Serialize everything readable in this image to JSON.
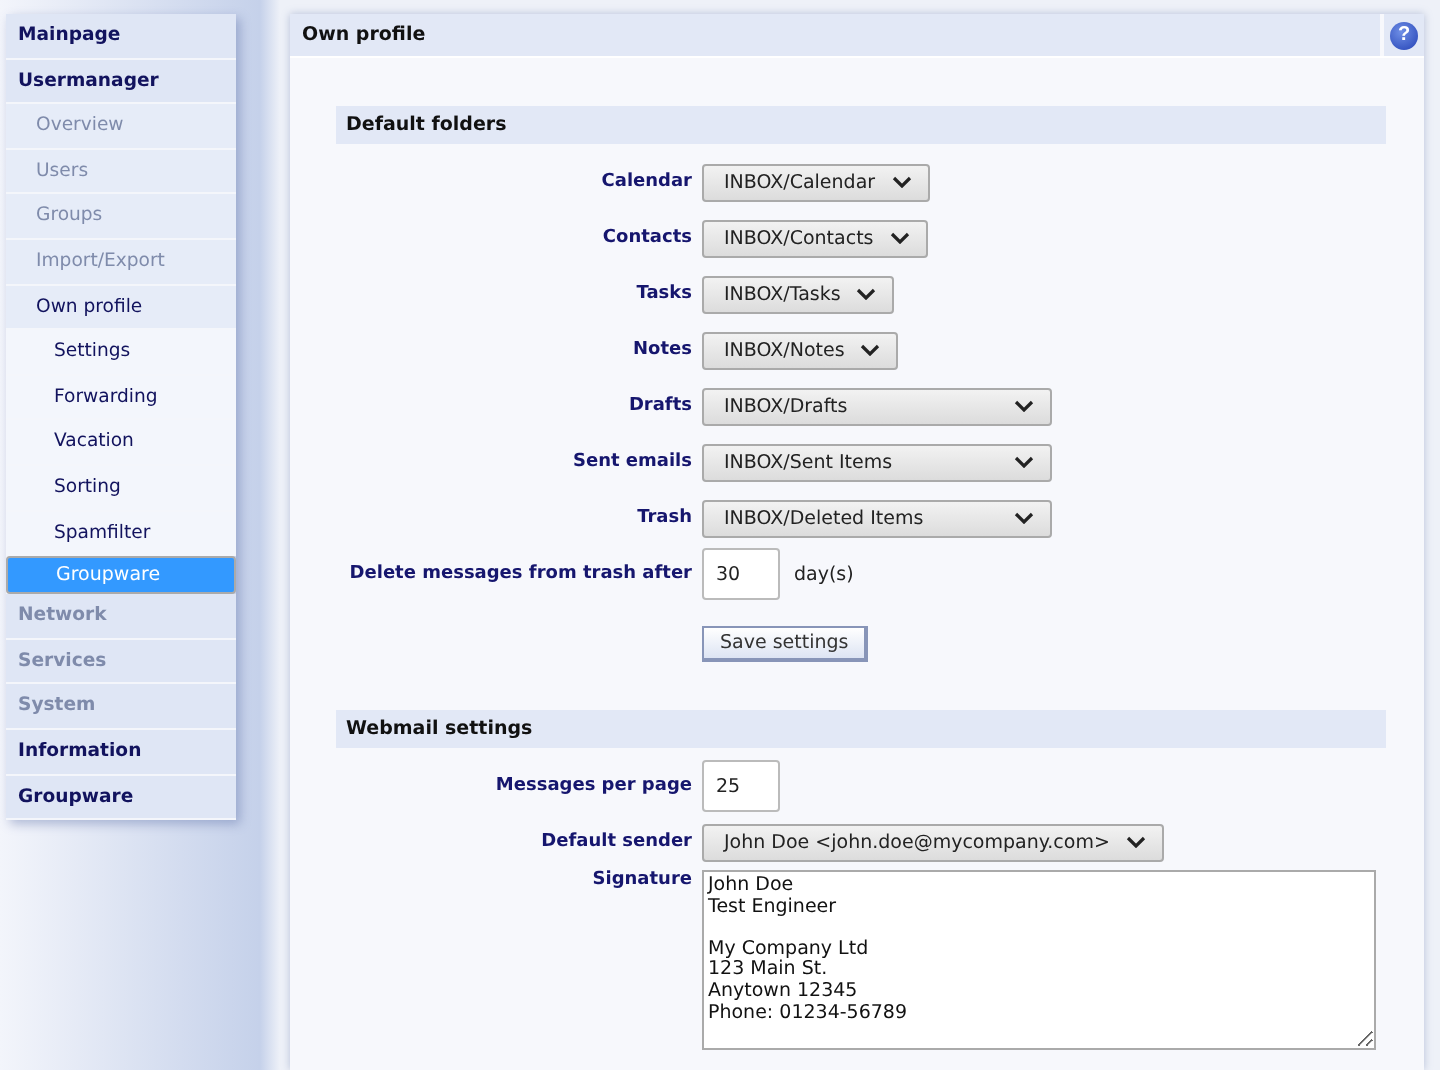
{
  "sidebar": {
    "items": [
      {
        "label": "Mainpage",
        "kind": "top",
        "disabled": false,
        "selected": false
      },
      {
        "label": "Usermanager",
        "kind": "top",
        "disabled": false,
        "selected": false
      },
      {
        "label": "Overview",
        "kind": "sub",
        "disabled": true,
        "selected": false
      },
      {
        "label": "Users",
        "kind": "sub",
        "disabled": true,
        "selected": false
      },
      {
        "label": "Groups",
        "kind": "sub",
        "disabled": true,
        "selected": false
      },
      {
        "label": "Import/Export",
        "kind": "sub",
        "disabled": true,
        "selected": false
      },
      {
        "label": "Own profile",
        "kind": "sub",
        "disabled": false,
        "selected": false
      },
      {
        "label": "Settings",
        "kind": "subsub",
        "disabled": false,
        "selected": false
      },
      {
        "label": "Forwarding",
        "kind": "subsub",
        "disabled": false,
        "selected": false
      },
      {
        "label": "Vacation",
        "kind": "subsub",
        "disabled": false,
        "selected": false
      },
      {
        "label": "Sorting",
        "kind": "subsub",
        "disabled": false,
        "selected": false
      },
      {
        "label": "Spamfilter",
        "kind": "subsub",
        "disabled": false,
        "selected": false
      },
      {
        "label": "Groupware",
        "kind": "subsub",
        "disabled": false,
        "selected": true
      },
      {
        "label": "Network",
        "kind": "top",
        "disabled": true,
        "selected": false
      },
      {
        "label": "Services",
        "kind": "top",
        "disabled": true,
        "selected": false
      },
      {
        "label": "System",
        "kind": "top",
        "disabled": true,
        "selected": false
      },
      {
        "label": "Information",
        "kind": "top",
        "disabled": false,
        "selected": false
      },
      {
        "label": "Groupware",
        "kind": "top",
        "disabled": false,
        "selected": false
      }
    ]
  },
  "panel": {
    "title": "Own profile",
    "help": "?"
  },
  "sections": [
    {
      "title": "Default folders",
      "rows": [
        {
          "label": "Calendar",
          "kind": "select",
          "value": "INBOX/Calendar"
        },
        {
          "label": "Contacts",
          "kind": "select",
          "value": "INBOX/Contacts"
        },
        {
          "label": "Tasks",
          "kind": "select",
          "value": "INBOX/Tasks"
        },
        {
          "label": "Notes",
          "kind": "select",
          "value": "INBOX/Notes"
        },
        {
          "label": "Drafts",
          "kind": "wideselect",
          "value": "INBOX/Drafts"
        },
        {
          "label": "Sent emails",
          "kind": "wideselect",
          "value": "INBOX/Sent Items"
        },
        {
          "label": "Trash",
          "kind": "wideselect",
          "value": "INBOX/Deleted Items"
        },
        {
          "label": "Delete messages from trash after",
          "kind": "number",
          "value": "30",
          "unit": "day(s)"
        },
        {
          "kind": "button",
          "value": "Save settings"
        }
      ]
    },
    {
      "title": "Webmail settings",
      "rows": [
        {
          "label": "Messages per page",
          "kind": "number",
          "value": "25"
        },
        {
          "label": "Default sender",
          "kind": "select",
          "value": "John Doe <john.doe@mycompany.com>"
        },
        {
          "label": "Signature",
          "kind": "textarea",
          "value": "John Doe\nTest Engineer\n\nMy Company Ltd\n123 Main St.\nAnytown 12345\nPhone: 01234-56789"
        }
      ]
    }
  ]
}
